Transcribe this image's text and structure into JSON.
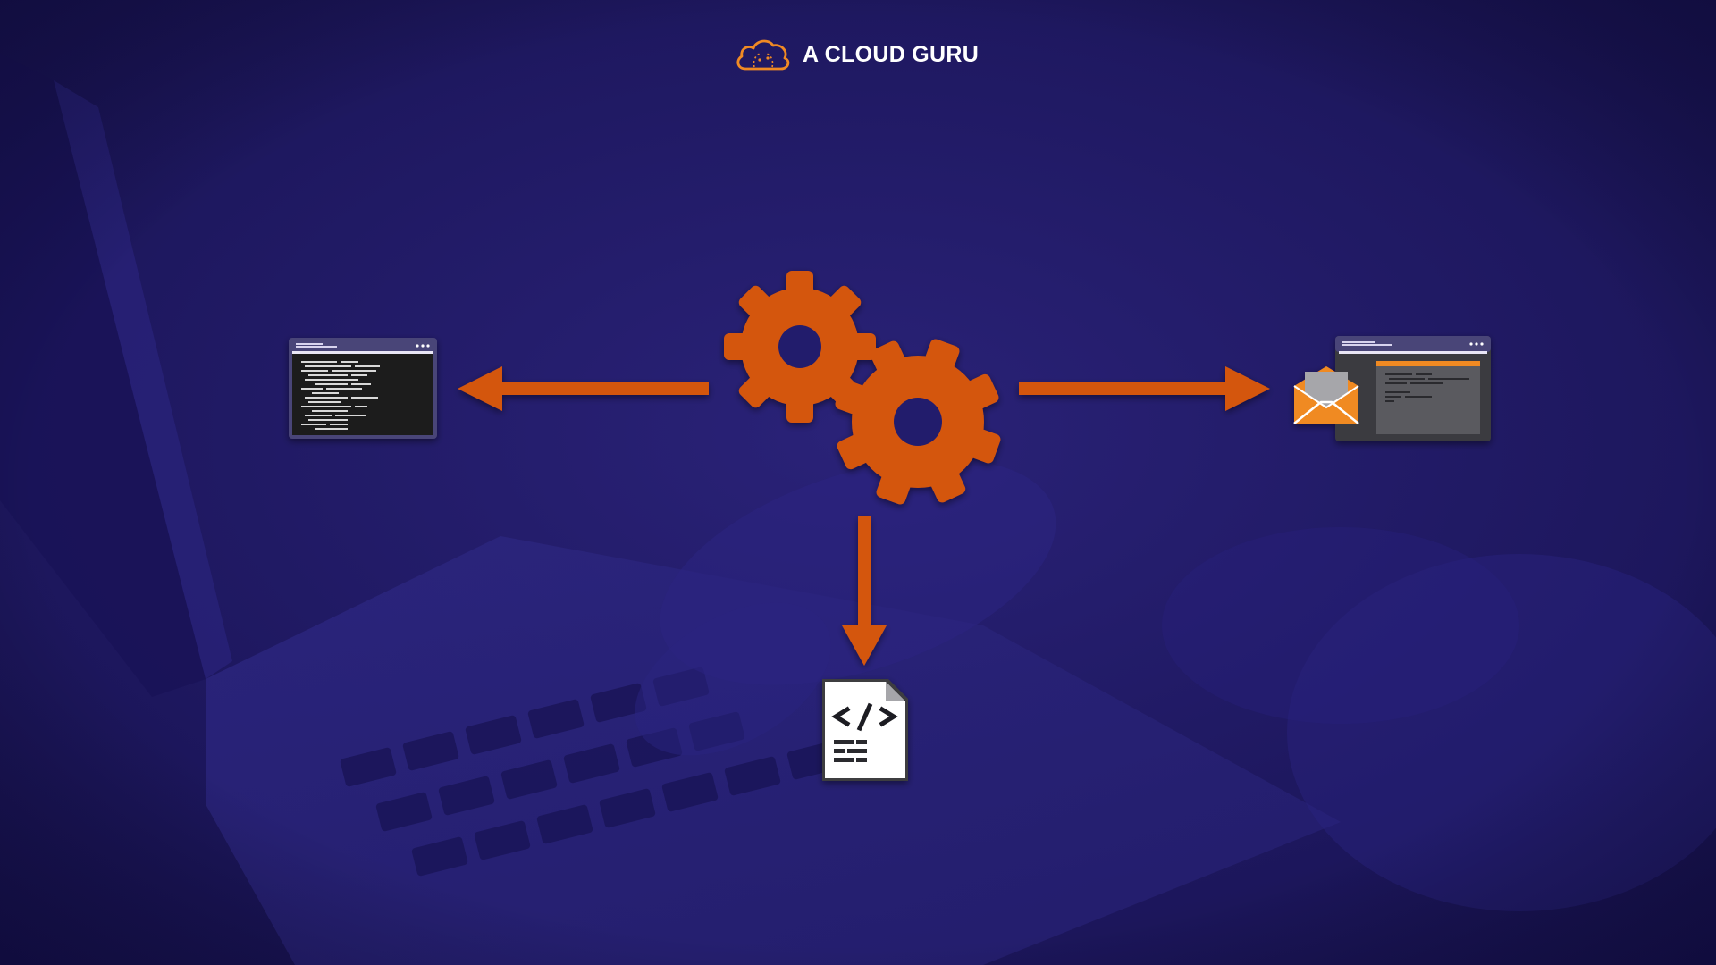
{
  "brand": {
    "name": "A CLOUD GURU",
    "logo_icon": "cloud-logo-icon"
  },
  "colors": {
    "background": "#1d1760",
    "accent": "#d4560e",
    "brand_orange": "#f08a24",
    "window_frame": "#4a4478",
    "terminal_bg": "#1b1a1e",
    "app_panel": "#5a5a5e"
  },
  "diagram": {
    "center": {
      "icon": "gears-icon"
    },
    "targets": [
      {
        "icon": "terminal-window-icon",
        "direction": "left"
      },
      {
        "icon": "email-notification-icon",
        "direction": "right"
      },
      {
        "icon": "code-file-icon",
        "direction": "down"
      }
    ]
  }
}
